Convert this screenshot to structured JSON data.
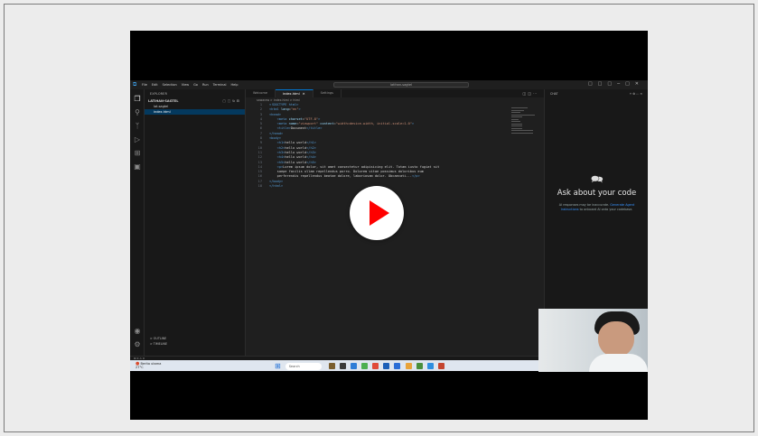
{
  "vscode": {
    "menu": [
      "File",
      "Edit",
      "Selection",
      "View",
      "Go",
      "Run",
      "Terminal",
      "Help"
    ],
    "search_placeholder": "latihan-sagtel",
    "sidebar_title": "EXPLORER",
    "folder": "LATIHAN-SAGTEL",
    "files": [
      "lat.sagtel",
      "index.html"
    ],
    "outline": [
      "OUTLINE",
      "TIMELINE"
    ],
    "tabs": [
      {
        "label": "Welcome"
      },
      {
        "label": "index.html"
      },
      {
        "label": "Settings"
      }
    ],
    "breadcrumb": "sawaraw > index.html > html",
    "code_lines": [
      {
        "num": "1",
        "html": "<span class='tag'>&lt;!DOCTYPE html&gt;</span>"
      },
      {
        "num": "2",
        "html": "<span class='tag'>&lt;html</span> <span class='attr'>lang</span>=<span class='str'>\"en\"</span><span class='tag'>&gt;</span>"
      },
      {
        "num": "3",
        "html": "<span class='tag'>&lt;head&gt;</span>"
      },
      {
        "num": "4",
        "html": "    <span class='tag'>&lt;meta</span> <span class='attr'>charset</span>=<span class='str'>\"UTF-8\"</span><span class='tag'>&gt;</span>"
      },
      {
        "num": "5",
        "html": "    <span class='tag'>&lt;meta</span> <span class='attr'>name</span>=<span class='str'>\"viewport\"</span> <span class='attr'>content</span>=<span class='str'>\"width=device-width, initial-scale=1.0\"</span><span class='tag'>&gt;</span>"
      },
      {
        "num": "6",
        "html": "    <span class='tag'>&lt;title&gt;</span>Document<span class='tag'>&lt;/title&gt;</span>"
      },
      {
        "num": "7",
        "html": "<span class='tag'>&lt;/head&gt;</span>"
      },
      {
        "num": "8",
        "html": "<span class='tag'>&lt;body&gt;</span>"
      },
      {
        "num": "9",
        "html": "    <span class='tag'>&lt;h1&gt;</span>hello world<span class='tag'>&lt;/h1&gt;</span>"
      },
      {
        "num": "10",
        "html": "    <span class='tag'>&lt;h2&gt;</span>hello world<span class='tag'>&lt;/h2&gt;</span>"
      },
      {
        "num": "11",
        "html": "    <span class='tag'>&lt;h3&gt;</span>hello world<span class='tag'>&lt;/h3&gt;</span>"
      },
      {
        "num": "12",
        "html": "    <span class='tag'>&lt;h4&gt;</span>hello world<span class='tag'>&lt;/h4&gt;</span>"
      },
      {
        "num": "13",
        "html": "    <span class='tag'>&lt;h5&gt;</span>hello world<span class='tag'>&lt;/h5&gt;</span>"
      },
      {
        "num": "14",
        "html": "    <span class='tag'>&lt;p&gt;</span>Lorem ipsum dolor, sit amet consectetur adipisicing elit. Totam iusto fugiat sit"
      },
      {
        "num": "15",
        "html": "    saepe facilis ullam repellendus porro. Dolorem vitae possimus doloribus eum"
      },
      {
        "num": "16",
        "html": "    perferendis repellendus beatae dolore, laboriosam dolor. Obcaecati...<span class='tag'>&lt;/p&gt;</span>"
      },
      {
        "num": "17",
        "html": "<span class='tag'>&lt;/body&gt;</span>"
      },
      {
        "num": "18",
        "html": "<span class='tag'>&lt;/html&gt;</span>"
      }
    ],
    "chat": {
      "header": "CHAT",
      "title": "Ask about your code",
      "sub_1": "AI responses may be inaccurate.",
      "sub_link": "Generate Agent Instructions",
      "sub_2": "to onboard AI onto your codebase."
    },
    "status": "⊗ 0 ⚠ 0"
  },
  "taskbar": {
    "weather_line1": "Berita utama",
    "weather_line2": "27°C",
    "search": "Search"
  },
  "colors": {
    "play_red": "#ff0000",
    "vscode_blue": "#0078d4"
  }
}
